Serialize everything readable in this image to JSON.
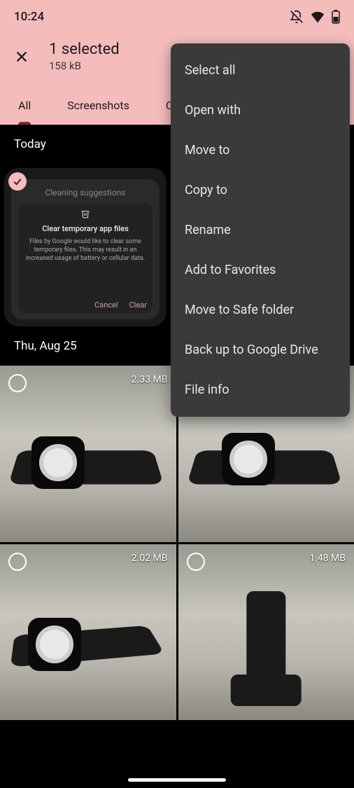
{
  "status": {
    "time": "10:24"
  },
  "header": {
    "selected_count": "1 selected",
    "selected_size": "158 kB"
  },
  "tabs": [
    {
      "label": "All",
      "active": true
    },
    {
      "label": "Screenshots",
      "active": false
    },
    {
      "label": "C",
      "active": false
    }
  ],
  "sections": [
    {
      "title": "Today"
    },
    {
      "title": "Thu, Aug 25"
    }
  ],
  "dialog": {
    "bar_title": "Cleaning suggestions",
    "heading": "Clear temporary app files",
    "body": "Files by Google would like to clear some temporary files. This may result in an increased usage of battery or cellular data.",
    "cancel": "Cancel",
    "clear": "Clear"
  },
  "thumbs": {
    "row1": [
      {
        "size": "2.33 MB"
      },
      {
        "size": ""
      }
    ],
    "row2": [
      {
        "size": "2.02 MB"
      },
      {
        "size": "1.48 MB"
      }
    ]
  },
  "menu": {
    "items": [
      "Select all",
      "Open with",
      "Move to",
      "Copy to",
      "Rename",
      "Add to Favorites",
      "Move to Safe folder",
      "Back up to Google Drive",
      "File info"
    ]
  }
}
